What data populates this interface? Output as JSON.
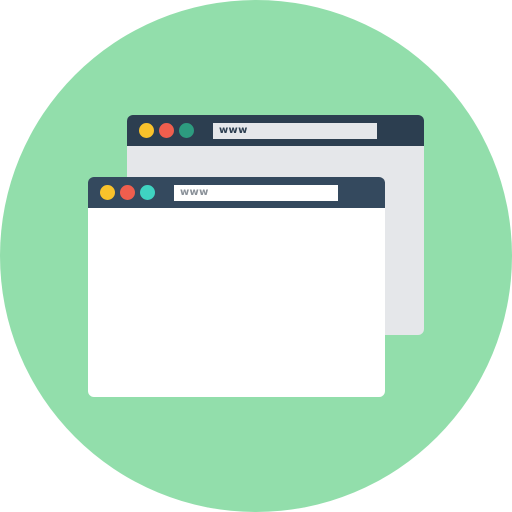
{
  "colors": {
    "background_circle": "#92deab",
    "titlebar_back": "#2c3e50",
    "titlebar_front": "#34495e",
    "window_body_back": "#e5e7ea",
    "window_body_front": "#ffffff",
    "dot_yellow": "#f9c22b",
    "dot_red": "#ef5e4e",
    "dot_teal_back": "#2d9b7f",
    "dot_teal_front": "#3fd3c1",
    "address_bar_back": "#e5e7ea",
    "address_bar_front": "#ffffff",
    "address_text_back": "#2c3e50",
    "address_text_front": "#8a9199"
  },
  "windows": [
    {
      "id": "back",
      "address_text": "www",
      "icons": [
        "minimize-dot-icon",
        "close-dot-icon",
        "maximize-dot-icon"
      ]
    },
    {
      "id": "front",
      "address_text": "www",
      "icons": [
        "minimize-dot-icon",
        "close-dot-icon",
        "maximize-dot-icon"
      ]
    }
  ]
}
